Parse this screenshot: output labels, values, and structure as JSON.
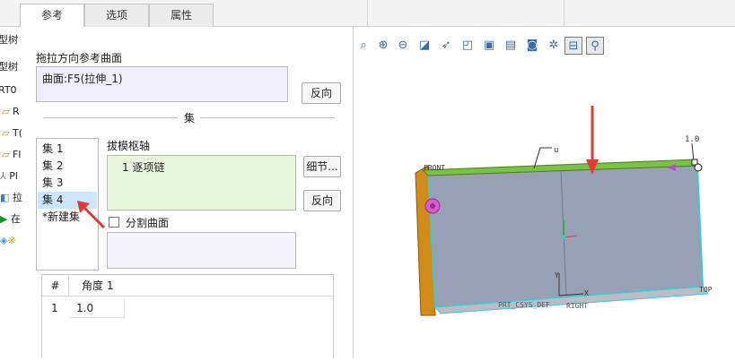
{
  "tabs": [
    {
      "label": "参考"
    },
    {
      "label": "选项"
    },
    {
      "label": "属性"
    }
  ],
  "tree": {
    "rows": [
      "型树",
      "型树",
      "RT0",
      "R",
      "T(",
      "FI",
      "Pl",
      "拉",
      "在",
      "※"
    ]
  },
  "dialog": {
    "ref_surface_label": "拖拉方向参考曲面",
    "ref_surface_value": "曲面:F5(拉伸_1)",
    "reverse_button": "反向",
    "set_section_label": "集",
    "sets": [
      "集 1",
      "集 2",
      "集 3",
      "集 4",
      "*新建集"
    ],
    "selected_set": "集 4",
    "pivot_label": "拔模枢轴",
    "pivot_value": "1 逐项链",
    "details_button": "细节...",
    "pivot_reverse_button": "反向",
    "split_surface_label": "分割曲面",
    "split_surface_checked": false,
    "table": {
      "headers": [
        "#",
        "角度 1"
      ],
      "rows": [
        [
          "1",
          "1.0"
        ]
      ]
    }
  },
  "viewport": {
    "labels": {
      "front": "FRONT",
      "top": "TOP",
      "csys": "PRT_CSYS_DEF",
      "right": "RIGHT",
      "pivot_mark": "1.0",
      "u_mark": "u",
      "y_axis": "Y",
      "x_axis": "X"
    },
    "colors": {
      "face": "#97a0b5",
      "edge_highlight": "#7bc143",
      "side_face": "#d38b17",
      "arrow": "#e53935",
      "outline": "#3fc8cf"
    }
  },
  "toolbar_icons": [
    "zoom-fit-icon",
    "zoom-in-icon",
    "zoom-out-icon",
    "repaint-icon",
    "orient-icon",
    "saved-views-icon",
    "display-style-icon",
    "layers-icon",
    "camera-icon",
    "datum-display-icon",
    "annotation-icon",
    "spin-center-icon"
  ]
}
